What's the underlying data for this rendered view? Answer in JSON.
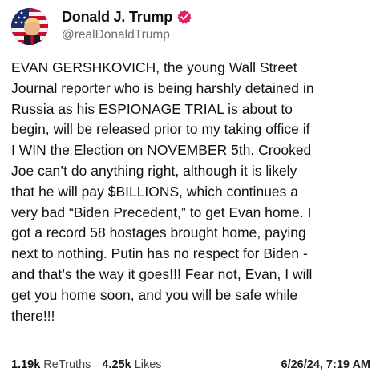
{
  "author": {
    "display_name": "Donald J. Trump",
    "handle": "@realDonaldTrump",
    "verified": true,
    "avatar_icon": "profile-photo-flag",
    "verified_color": "#e0245e"
  },
  "post": {
    "text": "EVAN GERSHKOVICH, the young Wall Street\nJournal reporter who is being harshly detained in\nRussia as his ESPIONAGE TRIAL is about to\nbegin, will be released prior to my taking office if\nI WIN the Election on NOVEMBER 5th. Crooked\nJoe can’t do anything right, although it is likely\nthat he will pay $BILLIONS, which continues a\nvery bad “Biden Precedent,” to get Evan home. I\ngot a record 58 hostages brought home, paying\nnext to nothing. Putin has no respect for Biden -\nand that’s the way it goes!!! Fear not, Evan, I will\nget you home soon, and you will be safe while\nthere!!!"
  },
  "stats": {
    "retruths_count": "1.19k",
    "retruths_label": "ReTruths",
    "likes_count": "4.25k",
    "likes_label": "Likes",
    "timestamp": "6/26/24, 7:19 AM"
  }
}
